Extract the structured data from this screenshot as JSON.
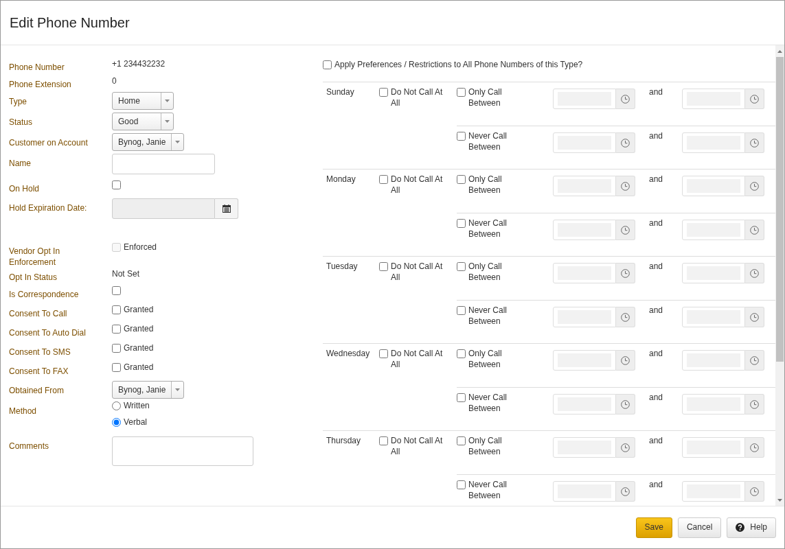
{
  "dialog": {
    "title": "Edit Phone Number"
  },
  "fields": [
    {
      "kind": "text",
      "label": "Phone Number",
      "value": "+1 234432232"
    },
    {
      "kind": "text",
      "label": "Phone Extension",
      "value": "0"
    },
    {
      "kind": "select",
      "label": "Type",
      "value": "Home"
    },
    {
      "kind": "select",
      "label": "Status",
      "value": "Good"
    },
    {
      "kind": "select",
      "label": "Customer on Account",
      "value": "Bynog, Janie"
    },
    {
      "kind": "input",
      "label": "Name"
    },
    {
      "kind": "checkbox",
      "label": "On Hold",
      "checked": false
    },
    {
      "kind": "date",
      "label": "Hold Expiration Date:",
      "disabled": true
    },
    {
      "kind": "checkbox",
      "label": "Vendor Opt In Enforcement",
      "checked": false,
      "disabled": true,
      "option": "Enforced"
    },
    {
      "kind": "text",
      "label": "Opt In Status",
      "value": "Not Set"
    },
    {
      "kind": "checkbox",
      "label": "Is Correspondence",
      "checked": false
    },
    {
      "kind": "checkbox",
      "label": "Consent To Call",
      "checked": false,
      "option": "Granted"
    },
    {
      "kind": "checkbox",
      "label": "Consent To Auto Dial",
      "checked": false,
      "option": "Granted"
    },
    {
      "kind": "checkbox",
      "label": "Consent To SMS",
      "checked": false,
      "option": "Granted"
    },
    {
      "kind": "checkbox",
      "label": "Consent To FAX",
      "checked": false,
      "option": "Granted"
    },
    {
      "kind": "select",
      "label": "Obtained From",
      "value": "Bynog, Janie"
    },
    {
      "kind": "radio",
      "label": "Method",
      "options": [
        {
          "label": "Written",
          "selected": false
        },
        {
          "label": "Verbal",
          "selected": true
        }
      ]
    },
    {
      "kind": "textarea",
      "label": "Comments"
    }
  ],
  "apply_all": {
    "label": "Apply Preferences / Restrictions to All Phone Numbers of this Type?",
    "checked": false
  },
  "days": [
    {
      "name": "Sunday",
      "do_not_call": {
        "label": "Do Not Call At All",
        "checked": false
      },
      "rules": [
        {
          "label": "Only Call Between",
          "checked": false,
          "joiner": "and"
        },
        {
          "label": "Never Call Between",
          "checked": false,
          "joiner": "and"
        }
      ]
    },
    {
      "name": "Monday",
      "do_not_call": {
        "label": "Do Not Call At All",
        "checked": false
      },
      "rules": [
        {
          "label": "Only Call Between",
          "checked": false,
          "joiner": "and"
        },
        {
          "label": "Never Call Between",
          "checked": false,
          "joiner": "and"
        }
      ]
    },
    {
      "name": "Tuesday",
      "do_not_call": {
        "label": "Do Not Call At All",
        "checked": false
      },
      "rules": [
        {
          "label": "Only Call Between",
          "checked": false,
          "joiner": "and"
        },
        {
          "label": "Never Call Between",
          "checked": false,
          "joiner": "and"
        }
      ]
    },
    {
      "name": "Wednesday",
      "do_not_call": {
        "label": "Do Not Call At All",
        "checked": false
      },
      "rules": [
        {
          "label": "Only Call Between",
          "checked": false,
          "joiner": "and"
        },
        {
          "label": "Never Call Between",
          "checked": false,
          "joiner": "and"
        }
      ]
    },
    {
      "name": "Thursday",
      "do_not_call": {
        "label": "Do Not Call At All",
        "checked": false
      },
      "rules": [
        {
          "label": "Only Call Between",
          "checked": false,
          "joiner": "and"
        },
        {
          "label": "Never Call Between",
          "checked": false,
          "joiner": "and"
        }
      ]
    }
  ],
  "buttons": [
    {
      "label": "Save",
      "kind": "primary"
    },
    {
      "label": "Cancel",
      "kind": "default"
    },
    {
      "label": "Help",
      "kind": "help"
    }
  ]
}
